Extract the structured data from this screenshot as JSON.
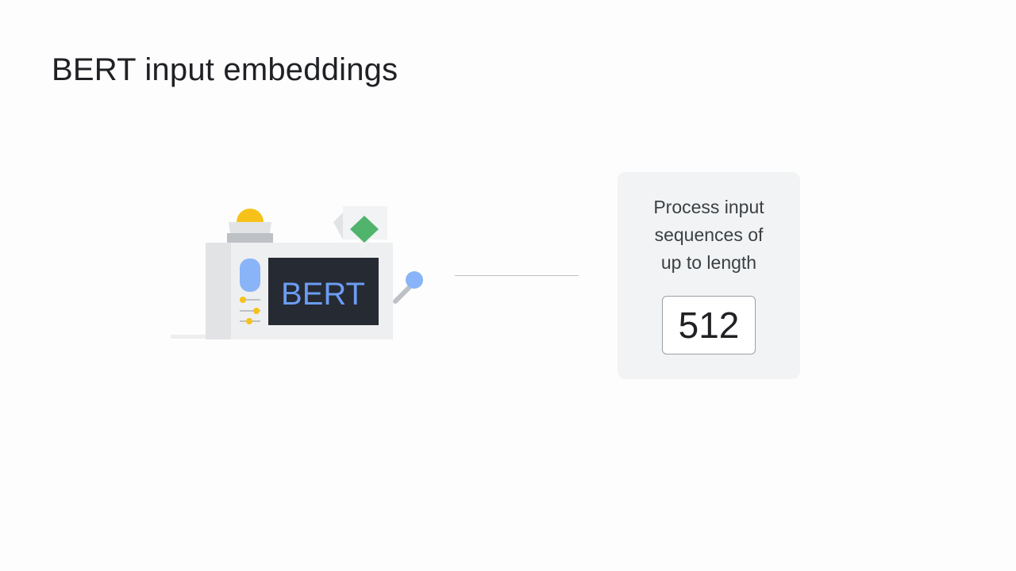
{
  "slide": {
    "title": "BERT input embeddings"
  },
  "machine": {
    "label": "BERT",
    "icon": "bert-machine-illustration"
  },
  "card": {
    "description": "Process input\nsequences of\nup to length",
    "value": "512"
  },
  "colors": {
    "screen": "#262a33",
    "screen_text": "#6b9cf2",
    "accent_yellow": "#f6c21a",
    "accent_green": "#34a853",
    "accent_blue": "#8ab4f8",
    "body": "#e8eaed",
    "card_bg": "#f1f3f4"
  }
}
